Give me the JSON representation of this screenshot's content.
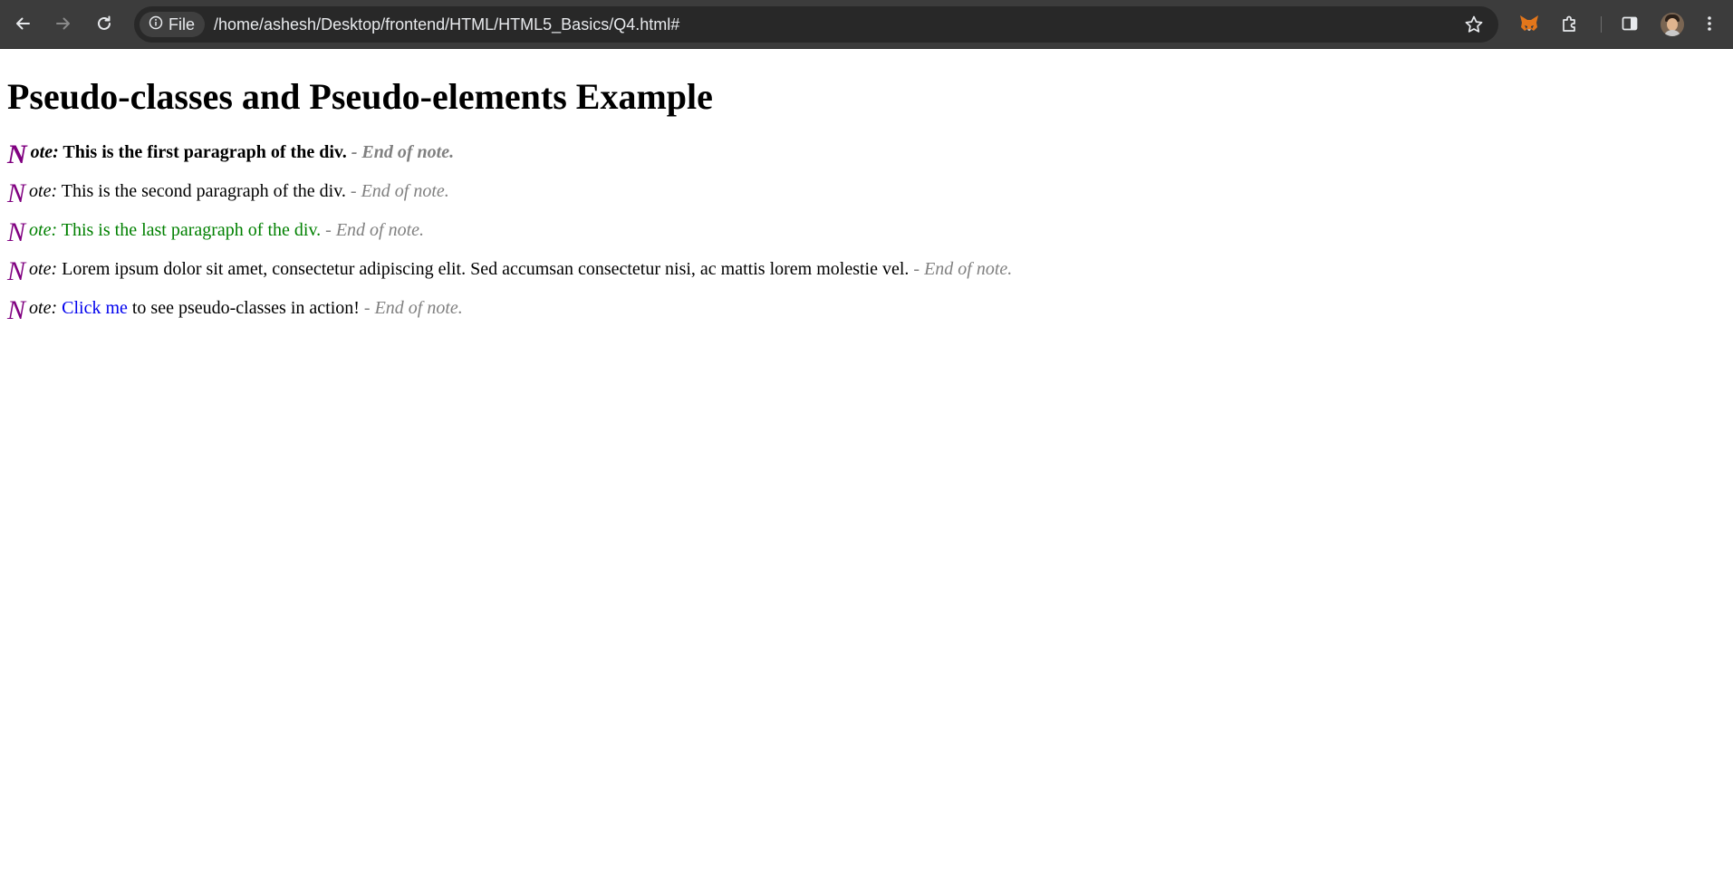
{
  "browser": {
    "chip_label": "File",
    "url": "/home/ashesh/Desktop/frontend/HTML/HTML5_Basics/Q4.html#",
    "icons": [
      "back-arrow-icon",
      "forward-arrow-icon",
      "reload-icon",
      "info-icon",
      "star-icon",
      "metamask-fox-icon",
      "puzzle-extension-icon",
      "side-panel-icon",
      "profile-avatar-icon",
      "kebab-menu-icon"
    ],
    "colors": {
      "toolbar": "#3c3c3c",
      "omnibox": "#282828",
      "chip": "#3f3f3f"
    }
  },
  "page": {
    "title": "Pseudo-classes and Pseudo-elements Example",
    "dropcap": "N",
    "prefix": "ote:",
    "suffix": "- End of note.",
    "notes": [
      {
        "text": "This is the first paragraph of the div."
      },
      {
        "text": "This is the second paragraph of the div."
      },
      {
        "text": "This is the last paragraph of the div."
      },
      {
        "text": "Lorem ipsum dolor sit amet, consectetur adipiscing elit. Sed accumsan consectetur nisi, ac mattis lorem molestie vel."
      },
      {
        "link_text": "Click me",
        "after_link": "to see pseudo-classes in action!"
      }
    ],
    "colors": {
      "dropcap": "#800080",
      "suffix": "#808080",
      "green": "#008000",
      "link": "#0000ee"
    }
  }
}
